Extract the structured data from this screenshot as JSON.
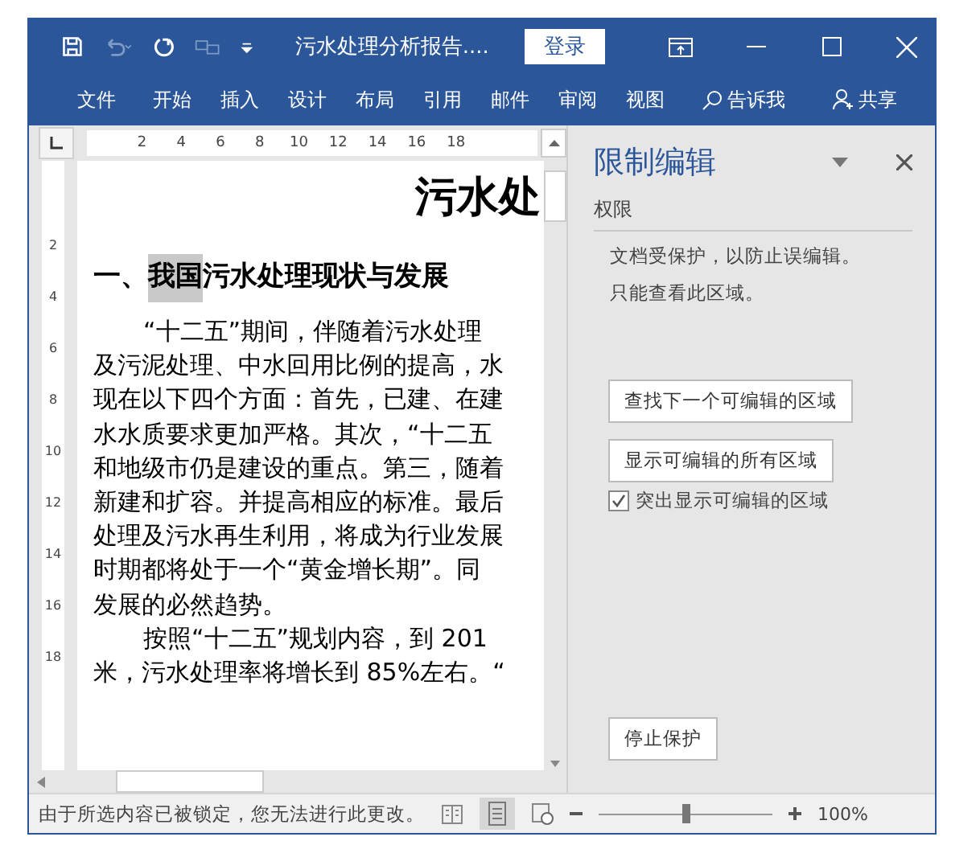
{
  "window": {
    "document_title": "污水处理分析报告....",
    "login": "登录"
  },
  "ribbon_tabs": [
    {
      "label": "文件",
      "kind": "file"
    },
    {
      "label": "开始",
      "kind": "tab"
    },
    {
      "label": "插入",
      "kind": "tab"
    },
    {
      "label": "设计",
      "kind": "tab"
    },
    {
      "label": "布局",
      "kind": "tab"
    },
    {
      "label": "引用",
      "kind": "tab"
    },
    {
      "label": "邮件",
      "kind": "tab"
    },
    {
      "label": "审阅",
      "kind": "tab"
    },
    {
      "label": "视图",
      "kind": "tab"
    },
    {
      "label": "告诉我",
      "kind": "search"
    },
    {
      "label": "共享",
      "kind": "share"
    }
  ],
  "ruler": {
    "horizontal": [
      "2",
      "4",
      "6",
      "8",
      "10",
      "12",
      "14",
      "16",
      "18"
    ],
    "vertical": [
      "2",
      "4",
      "6",
      "8",
      "10",
      "12",
      "14",
      "16",
      "18"
    ]
  },
  "document": {
    "title": "污水处",
    "heading": {
      "prefix": "一、",
      "highlighted": "我国",
      "rest": "污水处理现状与发展"
    },
    "lines": [
      {
        "text": "“十二五”期间，伴随着污水处理",
        "indent": true
      },
      {
        "text": "及污泥处理、中水回用比例的提高，水",
        "indent": false
      },
      {
        "text": "现在以下四个方面：首先，已建、在建",
        "indent": false
      },
      {
        "text": "水水质要求更加严格。其次，“十二五",
        "indent": false
      },
      {
        "text": "和地级市仍是建设的重点。第三，随着",
        "indent": false
      },
      {
        "text": "新建和扩容。并提高相应的标准。最后",
        "indent": false
      },
      {
        "text": "处理及污水再生利用，将成为行业发展",
        "indent": false
      },
      {
        "text": "时期都将处于一个“黄金增长期”。同",
        "indent": false
      },
      {
        "text": "发展的必然趋势。",
        "indent": false
      },
      {
        "text": "按照“十二五”规划内容，到 201",
        "indent": true
      },
      {
        "text": "米，污水处理率将增长到 85%左右。“",
        "indent": false
      }
    ]
  },
  "pane": {
    "title": "限制编辑",
    "section": "权限",
    "info": [
      "文档受保护，以防止误编辑。",
      "只能查看此区域。"
    ],
    "buttons": [
      "查找下一个可编辑的区域",
      "显示可编辑的所有区域"
    ],
    "highlight": {
      "label": "突出显示可编辑的区域",
      "checked": true
    },
    "stop_button": "停止保护"
  },
  "status_bar": {
    "message": "由于所选内容已被锁定，您无法进行此更改。",
    "zoom": {
      "level": 0.5,
      "reading": "100%"
    }
  }
}
